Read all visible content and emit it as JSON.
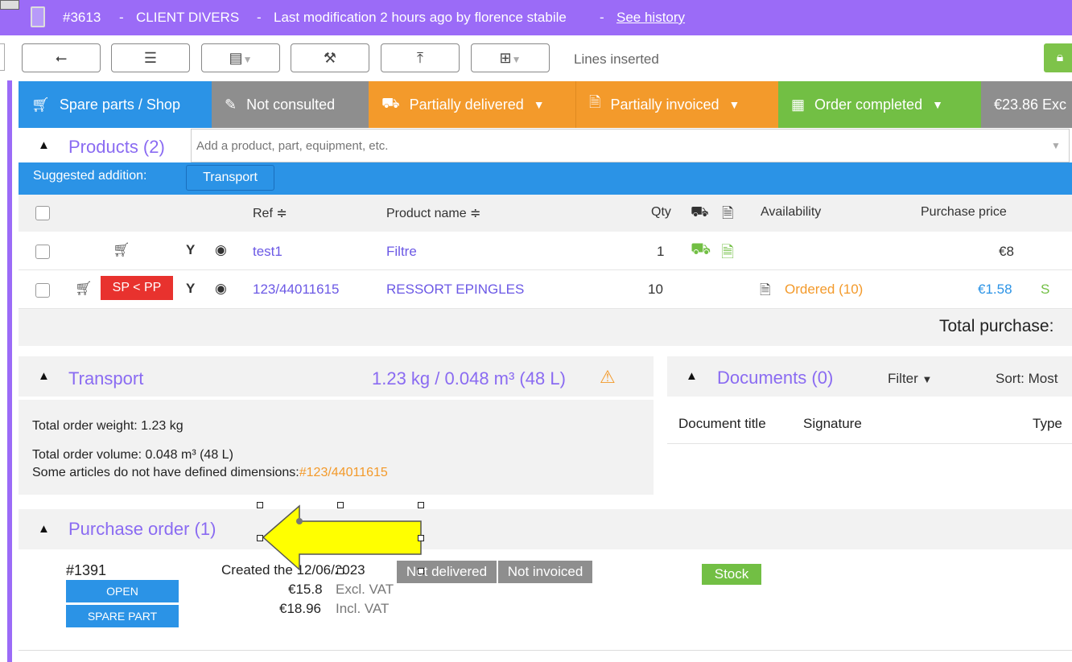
{
  "header": {
    "order_id": "#3613",
    "sep1": "-",
    "client": "CLIENT DIVERS",
    "sep2": "-",
    "modification": "Last modification 2 hours ago by florence stabile",
    "sep3": "-",
    "history_link": "See history"
  },
  "toolbar": {
    "status_text": "Lines inserted"
  },
  "status": {
    "type": "Spare parts / Shop",
    "consulted": "Not consulted",
    "delivery": "Partially delivered",
    "invoice": "Partially invoiced",
    "order": "Order completed",
    "amount": "€23.86 Exc",
    "caret": "▼"
  },
  "products": {
    "title": "Products (2)",
    "search_placeholder": "Add a product, part, equipment, etc.",
    "suggested_label": "Suggested addition:",
    "suggested_button": "Transport",
    "columns": {
      "ref": "Ref ≑",
      "name": "Product name ≑",
      "qty": "Qty",
      "availability": "Availability",
      "purchase_price": "Purchase price"
    },
    "rows": [
      {
        "ref": "test1",
        "name": "Filtre",
        "qty": "1",
        "availability": "",
        "price": "€8",
        "extra": ""
      },
      {
        "ref": "123/44011615",
        "name": "RESSORT EPINGLES",
        "qty": "10",
        "availability": "Ordered (10)",
        "price": "€1.58",
        "extra": "S",
        "badge": "SP < PP"
      }
    ],
    "total_label": "Total purchase:"
  },
  "transport": {
    "title": "Transport",
    "summary": "1.23 kg / 0.048 m³ (48 L)",
    "weight": "Total order weight: 1.23 kg",
    "volume": "Total order volume: 0.048 m³ (48 L)",
    "no_dims": "Some articles do not have defined dimensions:",
    "no_dims_ref": "#123/44011615"
  },
  "documents": {
    "title": "Documents (0)",
    "filter": "Filter",
    "sort": "Sort: Most",
    "col_title": "Document title",
    "col_signature": "Signature",
    "col_type": "Type"
  },
  "purchase_order": {
    "title": "Purchase order (1)",
    "number": "#1391",
    "btn_open": "OPEN",
    "btn_spare": "SPARE PART",
    "created": "Created the 12/06/2023",
    "excl_amount": "€15.8",
    "excl_label": "Excl. VAT",
    "incl_amount": "€18.96",
    "incl_label": "Incl. VAT",
    "delivery_status": "Not delivered",
    "invoice_status": "Not invoiced",
    "stock": "Stock"
  },
  "colors": {
    "purple": "#9b6bf7",
    "blue": "#2b93e6",
    "grey": "#8e8e8e",
    "orange": "#f39a2b",
    "green": "#72bf44",
    "red": "#e8322e",
    "arrow_yellow": "#ffff00"
  }
}
